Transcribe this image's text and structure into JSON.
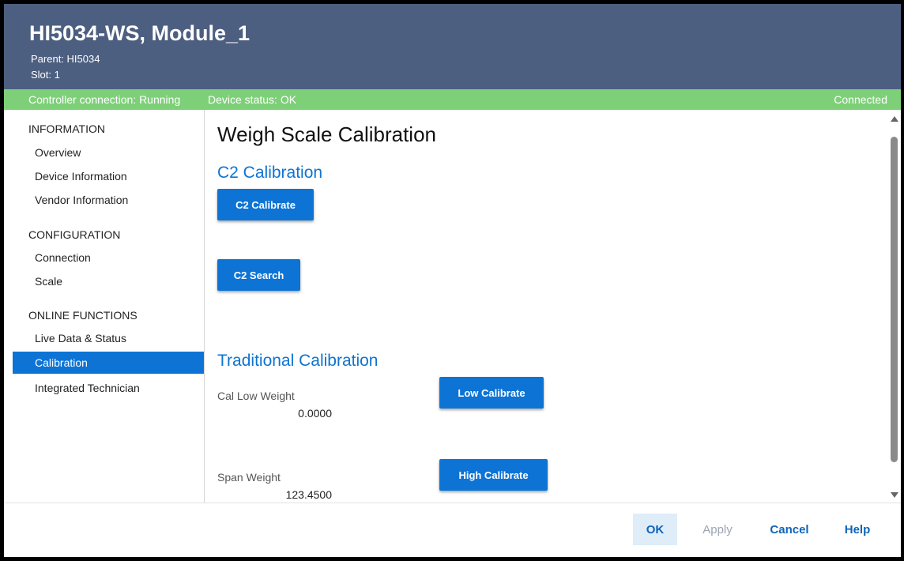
{
  "header": {
    "title": "HI5034-WS, Module_1",
    "parent": "Parent:  HI5034",
    "slot": "Slot:  1"
  },
  "status": {
    "controller": "Controller connection: Running",
    "device": "Device status: OK",
    "connection": "Connected"
  },
  "sidebar": {
    "sections": [
      {
        "label": "INFORMATION",
        "items": [
          {
            "label": "Overview"
          },
          {
            "label": "Device Information"
          },
          {
            "label": "Vendor Information"
          }
        ]
      },
      {
        "label": "CONFIGURATION",
        "items": [
          {
            "label": "Connection"
          },
          {
            "label": "Scale"
          }
        ]
      },
      {
        "label": "ONLINE FUNCTIONS",
        "items": [
          {
            "label": "Live Data & Status"
          },
          {
            "label": "Calibration",
            "active": true
          },
          {
            "label": "Integrated Technician"
          }
        ]
      }
    ]
  },
  "main": {
    "title": "Weigh Scale Calibration",
    "c2": {
      "title": "C2 Calibration",
      "calibrate_label": "C2 Calibrate",
      "search_label": "C2 Search"
    },
    "traditional": {
      "title": "Traditional Calibration",
      "low_weight_label": "Cal Low Weight",
      "low_weight_value": "0.0000",
      "low_calibrate_label": "Low Calibrate",
      "span_weight_label": "Span Weight",
      "span_weight_value": "123.4500",
      "high_calibrate_label": "High Calibrate"
    }
  },
  "footer": {
    "ok": "OK",
    "apply": "Apply",
    "cancel": "Cancel",
    "help": "Help"
  },
  "colors": {
    "header_bg": "#4d5f80",
    "status_bg": "#7dd077",
    "accent": "#0d74d6"
  }
}
